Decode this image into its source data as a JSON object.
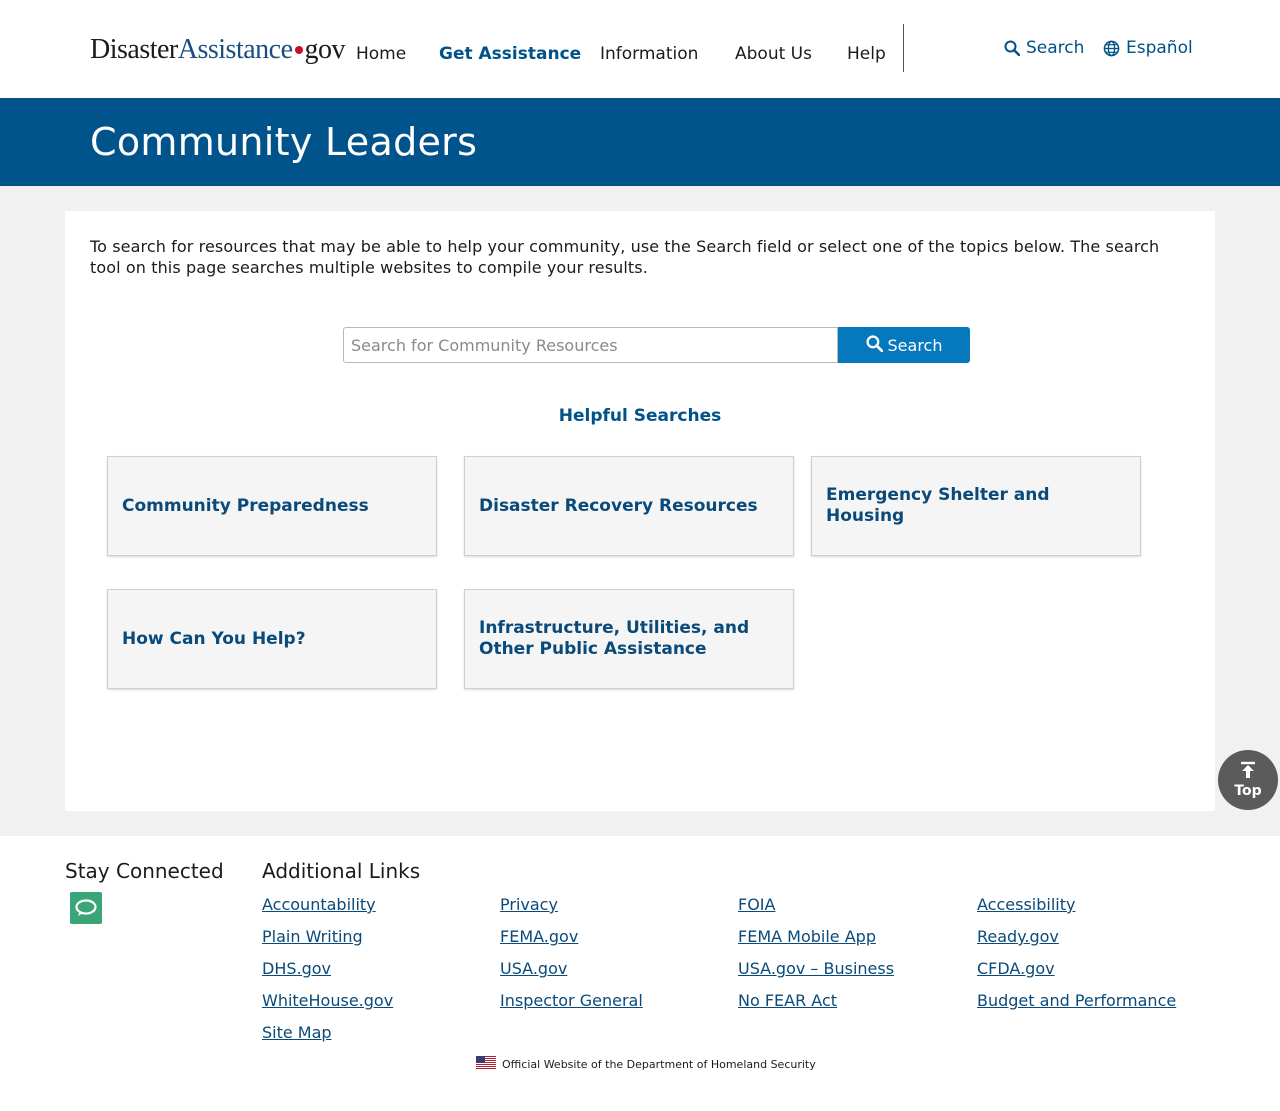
{
  "header": {
    "logo": {
      "part1": "Disaster",
      "part2": "Assistance",
      "part3": "gov"
    },
    "nav": [
      {
        "label": "Home",
        "active": false
      },
      {
        "label": "Get Assistance",
        "active": true
      },
      {
        "label": "Information",
        "active": false
      },
      {
        "label": "About Us",
        "active": false
      },
      {
        "label": "Help",
        "active": false
      }
    ],
    "search_label": "Search",
    "language_label": "Español"
  },
  "banner": {
    "title": "Community Leaders"
  },
  "main": {
    "intro": "To search for resources that may be able to help your community, use the Search field or select one of the topics below. The search tool on this page searches multiple websites to compile your results.",
    "search": {
      "placeholder": "Search for Community Resources",
      "value": "",
      "button_label": "Search"
    },
    "helpful_heading": "Helpful Searches",
    "tiles": [
      "Community Preparedness",
      "Disaster Recovery Resources",
      "Emergency Shelter and Housing",
      "How Can You Help?",
      "Infrastructure, Utilities, and Other Public Assistance"
    ]
  },
  "top_button": {
    "label": "Top"
  },
  "footer": {
    "stay_connected": "Stay Connected",
    "additional_links": "Additional Links",
    "links": [
      [
        "Accountability",
        "Plain Writing",
        "DHS.gov",
        "WhiteHouse.gov",
        "Site Map"
      ],
      [
        "Privacy",
        "FEMA.gov",
        "USA.gov",
        "Inspector General"
      ],
      [
        "FOIA",
        "FEMA Mobile App",
        "USA.gov – Business",
        "No FEAR Act"
      ],
      [
        "Accessibility",
        "Ready.gov",
        "CFDA.gov",
        "Budget and Performance"
      ]
    ],
    "official": "Official Website of the Department of Homeland Security"
  },
  "colors": {
    "primary": "#00538b",
    "link": "#005288",
    "button": "#0678be",
    "chat": "#3aa678"
  }
}
